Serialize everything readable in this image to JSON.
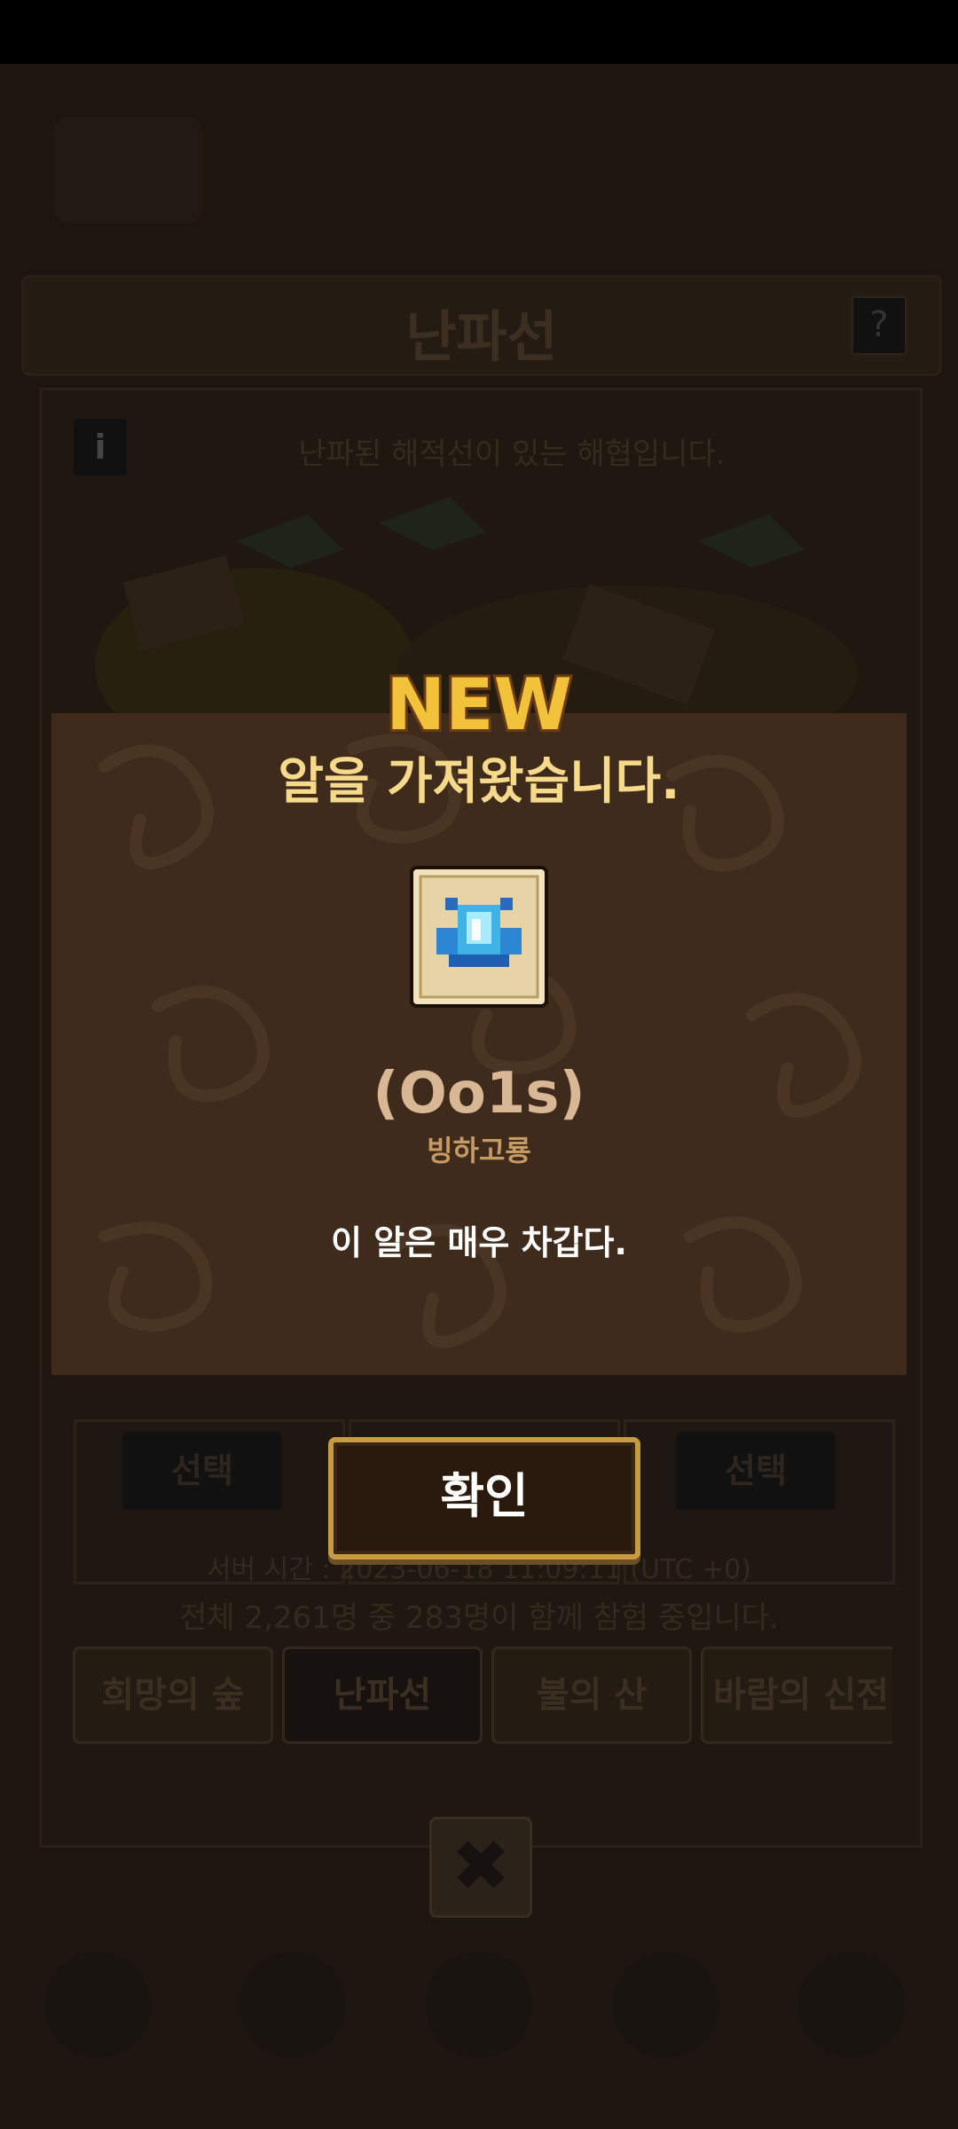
{
  "background": {
    "header_title": "난파선",
    "help_label": "?",
    "info_label": "i",
    "map_description": "난파된 해적선이 있는 해협입니다.",
    "slot_buttons": [
      "선택",
      "",
      "선택"
    ],
    "server_time": "서버 시간 : 2023-06-18 11:09:11 (UTC +0)",
    "player_count": "전체 2,261명 중 283명이 함께 참험 중입니다.",
    "area_tabs": [
      "희망의 숲",
      "난파선",
      "불의 산",
      "바람의 신전"
    ],
    "close_label": "✖"
  },
  "dialog": {
    "badge": "NEW",
    "title": "알을 가져왔습니다.",
    "item_icon": "ice-dragon-egg-icon",
    "item_name": "(Oo1s)",
    "item_subname": "빙하고룡",
    "item_description": "이 알은 매우 차갑다.",
    "confirm_label": "확인"
  },
  "colors": {
    "dialog_bg": "#3e2b1c",
    "title": "#f7d98b",
    "item_name": "#d8b894",
    "item_sub": "#c69a63",
    "button_border": "#c79a44"
  }
}
